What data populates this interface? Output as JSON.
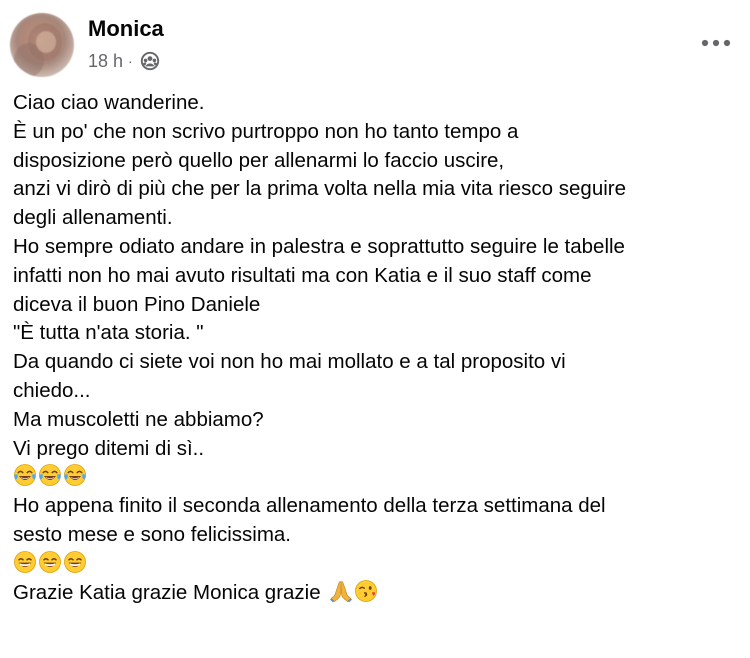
{
  "post": {
    "author": "Monica",
    "time": "18 h",
    "separator": "·",
    "audience_icon": "friends-audience-icon",
    "more_icon": "more-options-icon",
    "lines": [
      "Ciao ciao wanderine.",
      "È un po' che non scrivo purtroppo non ho tanto tempo a",
      "disposizione però quello per allenarmi lo faccio uscire,",
      "anzi vi dirò di più che per la prima volta nella mia vita riesco seguire",
      "degli allenamenti.",
      "Ho sempre odiato andare in palestra e soprattutto seguire le tabelle",
      "infatti non ho mai avuto risultati ma con Katia e il suo staff come",
      "diceva il buon Pino Daniele",
      "\"È tutta n'ata storia. \"",
      "Da quando ci siete voi non ho mai mollato e a tal proposito vi",
      "chiedo...",
      "Ma muscoletti ne abbiamo?",
      "Vi prego ditemi di sì..",
      "",
      "Ho appena finito il seconda allenamento della terza settimana del",
      "sesto mese e sono felicissima.",
      "",
      "Grazie Katia grazie Monica grazie"
    ],
    "emoji_lines": {
      "laughing_tears": "😂😂😂",
      "grinning": "😁😁😁",
      "closing": "🙏😘"
    },
    "colors": {
      "text": "#050505",
      "secondary": "#65676b",
      "background": "#ffffff"
    }
  }
}
